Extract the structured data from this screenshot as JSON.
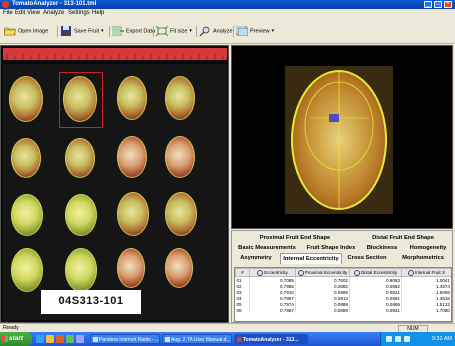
{
  "window": {
    "title": "TomatoAnalyzer - 313-101.tml",
    "controls": {
      "minimize": "_",
      "maximize": "□",
      "close": "×"
    }
  },
  "menu": {
    "items": [
      "File",
      "Edit",
      "View",
      "Analyze",
      "Settings",
      "Help"
    ]
  },
  "toolbar": {
    "open_image": "Open Image",
    "save_fruit": "Save Fruit",
    "export_data": "Export Data",
    "fit_size": "Fit size",
    "analyze": "Analyze",
    "preview": "Preview",
    "icons": [
      "folder-open-icon",
      "floppy-save-icon",
      "export-icon",
      "fit-size-icon",
      "magnifier-icon",
      "preview-icon"
    ]
  },
  "image": {
    "sample_label": "04S313-101"
  },
  "tabs": {
    "row1": [
      "Proximal Fruit End Shape",
      "Distal Fruit End Shape"
    ],
    "row2": [
      "Basic Measurements",
      "Fruit Shape Index",
      "Blockiness",
      "Homogeneity"
    ],
    "row3": [
      "Asymmetry",
      "Internal Eccentricity",
      "Cross Section",
      "Morphometrics"
    ],
    "active": "Internal Eccentricity"
  },
  "table": {
    "columns": [
      "#",
      "Eccentricity",
      "Proximal Eccentricity",
      "Distal Eccentricity",
      "Internal Fruit S"
    ],
    "rows": [
      [
        "01",
        "0.7085",
        "0.7602",
        "0.9063",
        "1.0041"
      ],
      [
        "02",
        "0.7965",
        "0.0882",
        "0.0852",
        "1.4674"
      ],
      [
        "03",
        "0.7910",
        "0.0889",
        "0.0821",
        "1.5065"
      ],
      [
        "04",
        "0.7987",
        "0.0913",
        "0.0881",
        "1.3516"
      ],
      [
        "05",
        "0.7974",
        "0.0889",
        "0.0889",
        "1.5122"
      ],
      [
        "06",
        "0.7987",
        "0.0889",
        "0.0831",
        "1.7080"
      ]
    ]
  },
  "status": {
    "text": "Ready",
    "num": "NUM"
  },
  "taskbar": {
    "start": "start",
    "tasks": [
      "Pandora Internet Radio - ...",
      "Aug. 2 TA User Manual.d...",
      "TomatoAnalyzer - 313..."
    ],
    "active_task": "TomatoAnalyzer - 313...",
    "clock": "9:32 AM"
  },
  "colors": {
    "titlebar": "#0a5bd4",
    "taskbar": "#2157d4",
    "ruler": "#d43a3a",
    "fruit_outline": "#e8e830"
  }
}
